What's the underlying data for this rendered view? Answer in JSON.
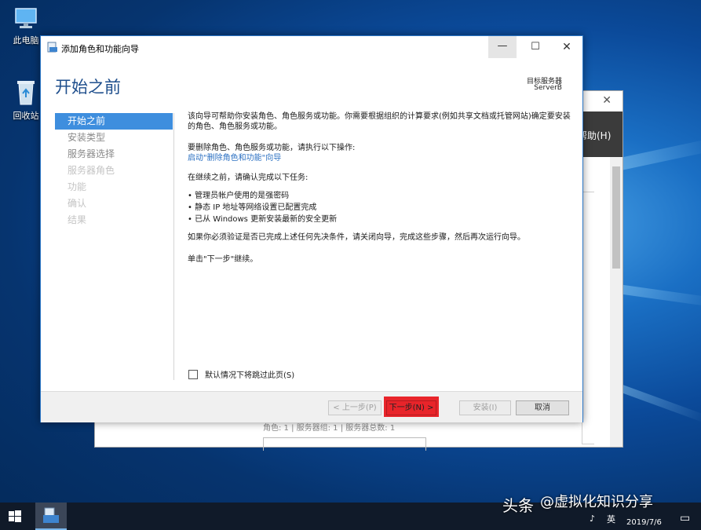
{
  "desktop": {
    "icons": [
      {
        "label": "此电脑",
        "icon": "computer-icon"
      },
      {
        "label": "回收站",
        "icon": "recycle-bin-icon"
      }
    ]
  },
  "background_window": {
    "help_menu": "帮助(H)",
    "stats_text": "角色: 1 | 服务器组: 1 | 服务器总数: 1"
  },
  "wizard": {
    "title": "添加角色和功能向导",
    "heading": "开始之前",
    "destination_label": "目标服务器",
    "destination_server": "ServerB",
    "nav": [
      {
        "label": "开始之前",
        "state": "active"
      },
      {
        "label": "安装类型",
        "state": "normal"
      },
      {
        "label": "服务器选择",
        "state": "normal"
      },
      {
        "label": "服务器角色",
        "state": "disabled"
      },
      {
        "label": "功能",
        "state": "disabled"
      },
      {
        "label": "确认",
        "state": "disabled"
      },
      {
        "label": "结果",
        "state": "disabled"
      }
    ],
    "content": {
      "intro": "该向导可帮助你安装角色、角色服务或功能。你需要根据组织的计算要求(例如共享文档或托管网站)确定要安装的角色、角色服务或功能。",
      "remove_text": "要删除角色、角色服务或功能，请执行以下操作:",
      "remove_link": "启动\"删除角色和功能\"向导",
      "before_text": "在继续之前，请确认完成以下任务:",
      "tasks": [
        "管理员帐户使用的是强密码",
        "静态 IP 地址等网络设置已配置完成",
        "已从 Windows 更新安装最新的安全更新"
      ],
      "verify_text": "如果你必须验证是否已完成上述任何先决条件，请关闭向导，完成这些步骤，然后再次运行向导。",
      "continue_text": "单击\"下一步\"继续。"
    },
    "skip_checkbox": {
      "label": "默认情况下将跳过此页(S)",
      "checked": false
    },
    "buttons": {
      "prev": "< 上一步(P)",
      "next": "下一步(N) >",
      "install": "安装(I)",
      "cancel": "取消"
    },
    "window_controls": {
      "minimize": "—",
      "maximize": "☐",
      "close": "✕"
    }
  },
  "taskbar": {
    "watermark_brand": "头条",
    "watermark_account": "@虚拟化知识分享",
    "tray_ime": "英",
    "date": "2019/7/6"
  },
  "colors": {
    "accent": "#3e8ede",
    "heading": "#1e4e8c",
    "link": "#2a6fc2",
    "highlight_red": "#e8242a",
    "taskbar": "#101a29"
  }
}
